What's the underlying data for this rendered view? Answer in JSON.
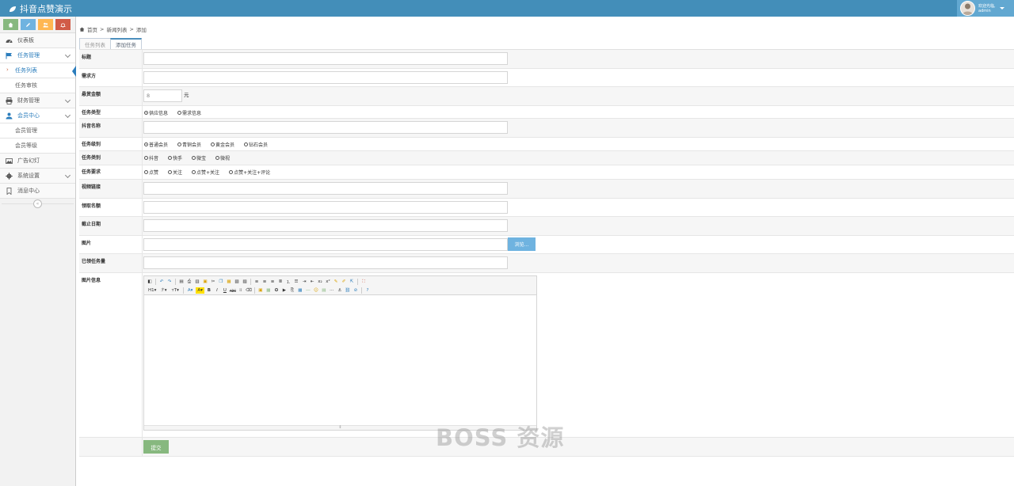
{
  "app": {
    "title": "抖音点赞演示"
  },
  "user": {
    "greeting": "欢迎光临,",
    "name": "admin"
  },
  "colors": {
    "navbar": "#438eb9",
    "shortcut_green": "#87b87f",
    "shortcut_blue": "#6fb3e0",
    "shortcut_orange": "#ffb752",
    "shortcut_red": "#d15b47",
    "submit": "#87b87f",
    "browse": "#6fb3e0"
  },
  "shortcuts": [
    {
      "icon": "home-icon"
    },
    {
      "icon": "pencil-icon"
    },
    {
      "icon": "users-icon"
    },
    {
      "icon": "bell-icon"
    }
  ],
  "sidebar": {
    "items": [
      {
        "label": "仪表板",
        "icon": "dashboard-icon"
      },
      {
        "label": "任务管理",
        "icon": "flag-icon",
        "open": true,
        "children": [
          "任务列表",
          "任务审核"
        ]
      },
      {
        "label": "财务管理",
        "icon": "printer-icon"
      },
      {
        "label": "会员中心",
        "icon": "user-icon",
        "open": true,
        "children": [
          "会员管理",
          "会员等级"
        ]
      },
      {
        "label": "广告幻灯",
        "icon": "picture-icon"
      },
      {
        "label": "系统设置",
        "icon": "cog-icon"
      },
      {
        "label": "消息中心",
        "icon": "bookmark-icon"
      }
    ]
  },
  "breadcrumb": [
    "首页",
    "新闻列表",
    "添加"
  ],
  "tabs": [
    "任务列表",
    "添加任务"
  ],
  "form": {
    "title_label": "标题",
    "requester_label": "需求方",
    "reward_label": "悬赏金额",
    "reward_placeholder": "8",
    "reward_unit": "元",
    "type_label": "任务类型",
    "type_options": [
      "供应信息",
      "需求信息"
    ],
    "douyin_name_label": "抖音名称",
    "level_label": "任务级别",
    "level_options": [
      "普通会员",
      "青铜会员",
      "黄金会员",
      "钻石会员"
    ],
    "category_label": "任务类别",
    "category_options": [
      "抖音",
      "快手",
      "微宝",
      "微视"
    ],
    "requirement_label": "任务要求",
    "requirement_options": [
      "点赞",
      "关注",
      "点赞+关注",
      "点赞+关注+评论"
    ],
    "video_link_label": "视频链接",
    "quota_label": "领取名额",
    "deadline_label": "截止日期",
    "image_label": "图片",
    "browse_label": "浏览...",
    "claimed_label": "已领任务量",
    "image_info_label": "图片信息",
    "toolbar_heading": "H1",
    "toolbar_font": "ℱ",
    "toolbar_size": "тT",
    "submit_label": "提交"
  },
  "watermark": "BOSS 资源"
}
